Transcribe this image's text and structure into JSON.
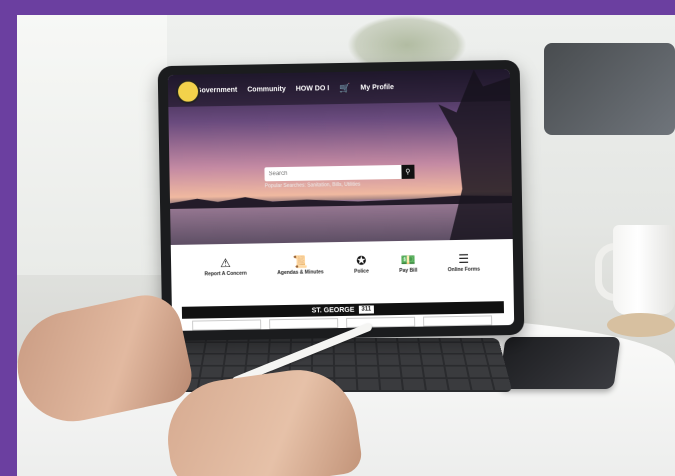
{
  "nav": {
    "items": [
      "Government",
      "Community",
      "HOW DO I",
      "My Profile"
    ]
  },
  "search": {
    "placeholder": "Search",
    "popular": "Popular Searches: Sanitation, Bills, Utilities"
  },
  "quicklinks": [
    {
      "label": "Report A Concern",
      "icon": "warning-icon"
    },
    {
      "label": "Agendas & Minutes",
      "icon": "scroll-icon"
    },
    {
      "label": "Police",
      "icon": "badge-icon"
    },
    {
      "label": "Pay Bill",
      "icon": "money-icon"
    },
    {
      "label": "Online Forms",
      "icon": "list-icon"
    }
  ],
  "banner": {
    "title": "ST. GEORGE",
    "badge": "311"
  },
  "colors": {
    "frame": "#6b3fa0",
    "hero_top": "#2d2140",
    "hero_sunset": "#f0b9a0"
  }
}
